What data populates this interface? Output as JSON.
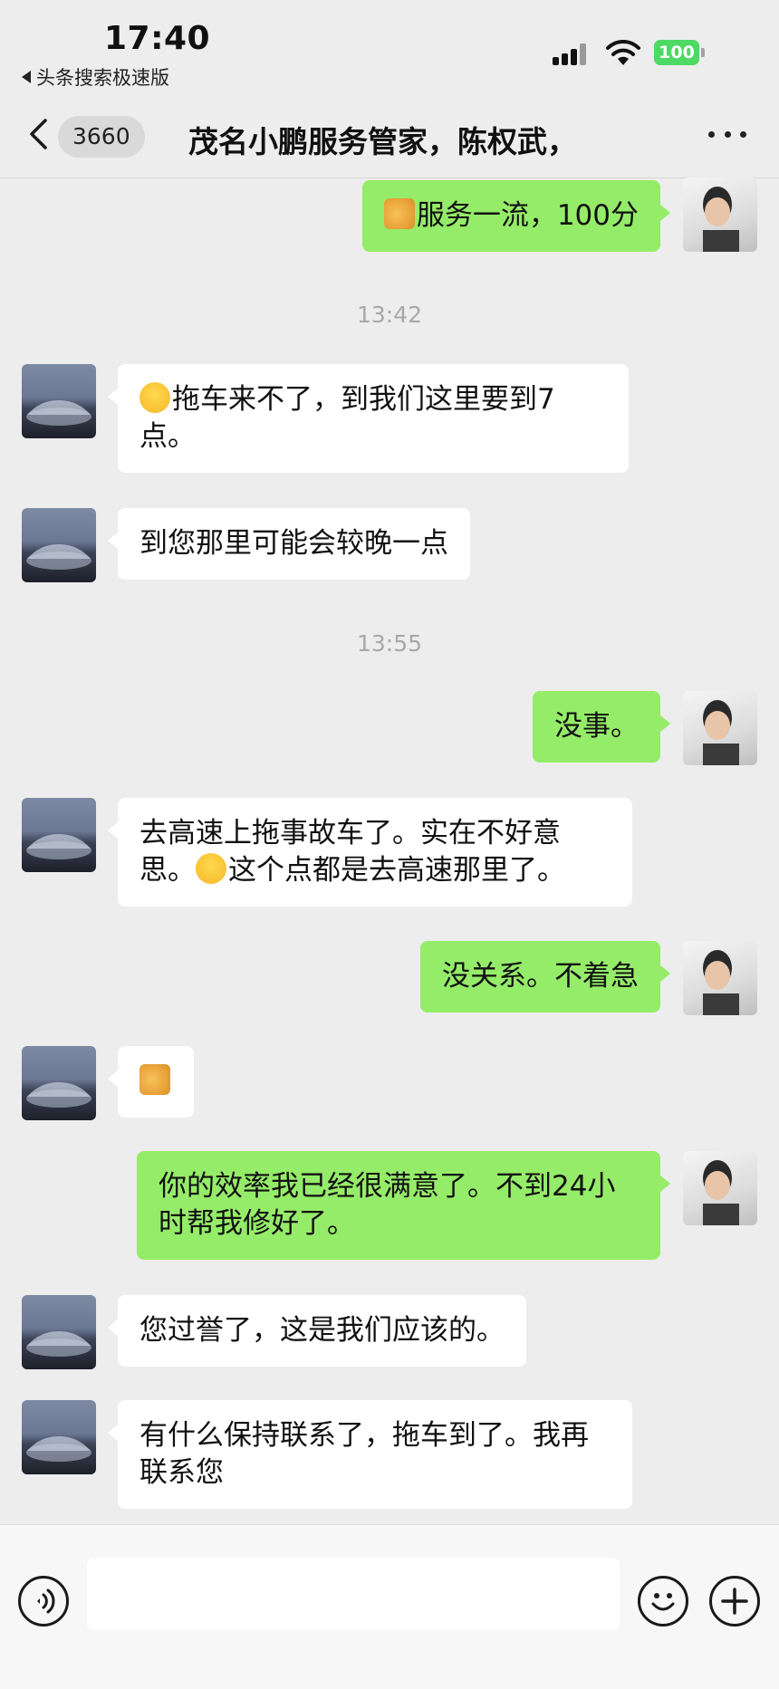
{
  "status_bar": {
    "time": "17:40",
    "back_app_label": "头条搜索极速版",
    "battery": "100"
  },
  "nav": {
    "unread_count": "3660",
    "title": "茂名小鹏服务管家，陈权武，"
  },
  "messages": {
    "m1": {
      "sender": "me",
      "emoji": "handshake-emoji",
      "text": "服务一流，100分"
    },
    "ts1": "13:42",
    "m2": {
      "sender": "agent",
      "emoji": "crying-emoji",
      "text": "拖车来不了，到我们这里要到7点。"
    },
    "m3": {
      "sender": "agent",
      "text": "到您那里可能会较晚一点"
    },
    "ts2": "13:55",
    "m4": {
      "sender": "me",
      "text": "没事。"
    },
    "m5": {
      "sender": "agent",
      "text_a": "去高速上拖事故车了。实在不好意思。",
      "emoji": "laughing-emoji",
      "text_b": "这个点都是去高速那里了。"
    },
    "m6": {
      "sender": "me",
      "text": "没关系。不着急"
    },
    "m7": {
      "sender": "agent",
      "emoji": "handshake-emoji"
    },
    "m8": {
      "sender": "me",
      "text": "你的效率我已经很满意了。不到24小时帮我修好了。"
    },
    "m9": {
      "sender": "agent",
      "text": "您过誉了，这是我们应该的。"
    },
    "m10": {
      "sender": "agent",
      "text": "有什么保持联系了，拖车到了。我再联系您"
    }
  },
  "input": {
    "placeholder": ""
  },
  "colors": {
    "background": "#ededed",
    "outgoing_bubble": "#95ec69",
    "incoming_bubble": "#ffffff",
    "battery": "#4cd964"
  }
}
